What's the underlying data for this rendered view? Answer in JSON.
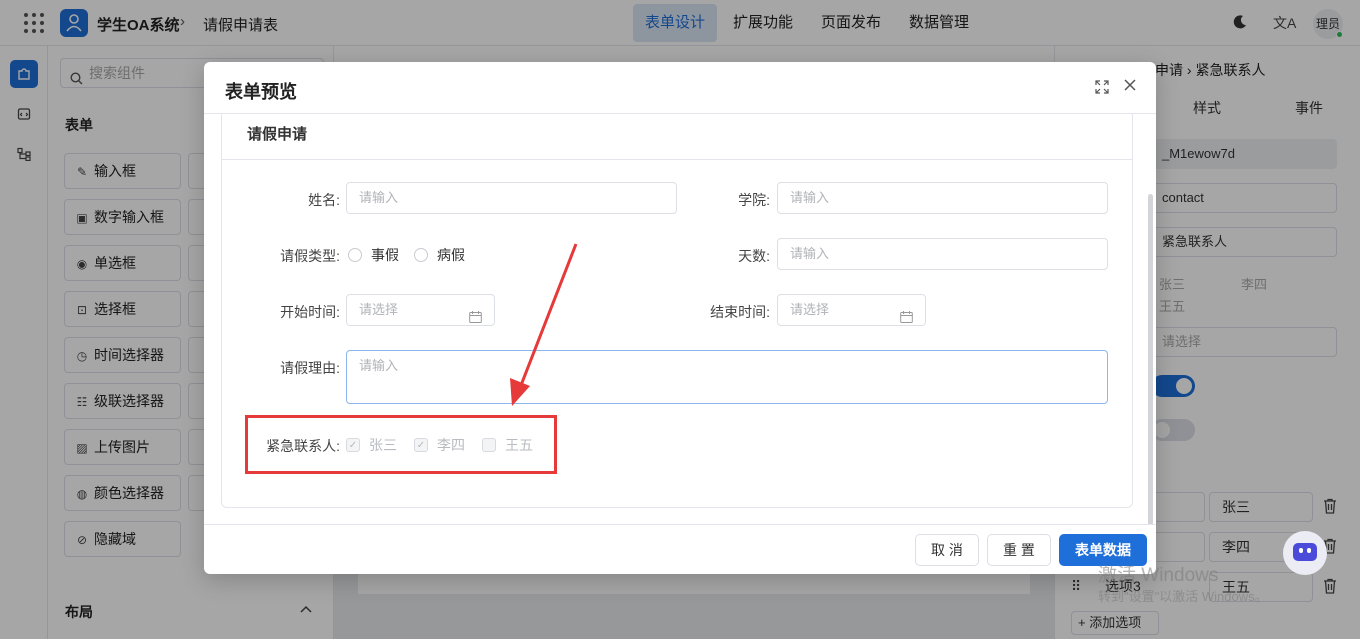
{
  "topbar": {
    "app_name": "学生OA系统",
    "crumb_sep": "›",
    "page_name": "请假申请表",
    "tabs": [
      {
        "label": "表单设计",
        "active": true
      },
      {
        "label": "扩展功能",
        "active": false
      },
      {
        "label": "页面发布",
        "active": false
      },
      {
        "label": "数据管理",
        "active": false
      }
    ],
    "avatar_text": "理员",
    "translate_glyph": "文A"
  },
  "component_panel": {
    "search_placeholder": "搜索组件",
    "form_section": "表单",
    "items": [
      {
        "icon": "pencil-icon",
        "glyph": "✎",
        "label": "输入框"
      },
      {
        "icon": "number-input-icon",
        "glyph": "▣",
        "label": "数字输入框"
      },
      {
        "icon": "radio-icon",
        "glyph": "◉",
        "label": "单选框"
      },
      {
        "icon": "select-icon",
        "glyph": "⊡",
        "label": "选择框"
      },
      {
        "icon": "clock-icon",
        "glyph": "◷",
        "label": "时间选择器"
      },
      {
        "icon": "cascader-icon",
        "glyph": "☷",
        "label": "级联选择器"
      },
      {
        "icon": "image-icon",
        "glyph": "▨",
        "label": "上传图片"
      },
      {
        "icon": "palette-icon",
        "glyph": "◍",
        "label": "颜色选择器"
      },
      {
        "icon": "eye-off-icon",
        "glyph": "⊘",
        "label": "隐藏域"
      }
    ],
    "layout_section": "布局"
  },
  "right_panel": {
    "crumb": "申请 › 紧急联系人",
    "tabs": [
      "样式",
      "事件"
    ],
    "field_id": "_M1ewow7d",
    "field_name": "contact",
    "field_label": "紧急联系人",
    "checks": [
      "张三",
      "李四",
      "王五"
    ],
    "select_placeholder": "请选择",
    "options": [
      {
        "label": "张三"
      },
      {
        "label": "李四"
      },
      {
        "label": "王五",
        "key": "选项3"
      }
    ],
    "add_option": "+ 添加选项"
  },
  "watermark": {
    "line1": "激活 Windows",
    "line2": "转到\"设置\"以激活 Windows。"
  },
  "dialog": {
    "title": "表单预览",
    "card_title": "请假申请",
    "fields": {
      "name_label": "姓名:",
      "name_placeholder": "请输入",
      "college_label": "学院:",
      "college_placeholder": "请输入",
      "leave_type_label": "请假类型:",
      "leave_type_options": [
        "事假",
        "病假"
      ],
      "days_label": "天数:",
      "days_placeholder": "请输入",
      "start_label": "开始时间:",
      "start_placeholder": "请选择",
      "end_label": "结束时间:",
      "end_placeholder": "请选择",
      "reason_label": "请假理由:",
      "reason_placeholder": "请输入",
      "contact_label": "紧急联系人:",
      "contact_options": [
        {
          "label": "张三",
          "checked": true
        },
        {
          "label": "李四",
          "checked": true
        },
        {
          "label": "王五",
          "checked": false
        }
      ]
    },
    "buttons": {
      "cancel": "取 消",
      "reset": "重 置",
      "submit": "表单数据"
    }
  },
  "colors": {
    "primary": "#1e6fd9",
    "highlight": "#e63a3a"
  }
}
